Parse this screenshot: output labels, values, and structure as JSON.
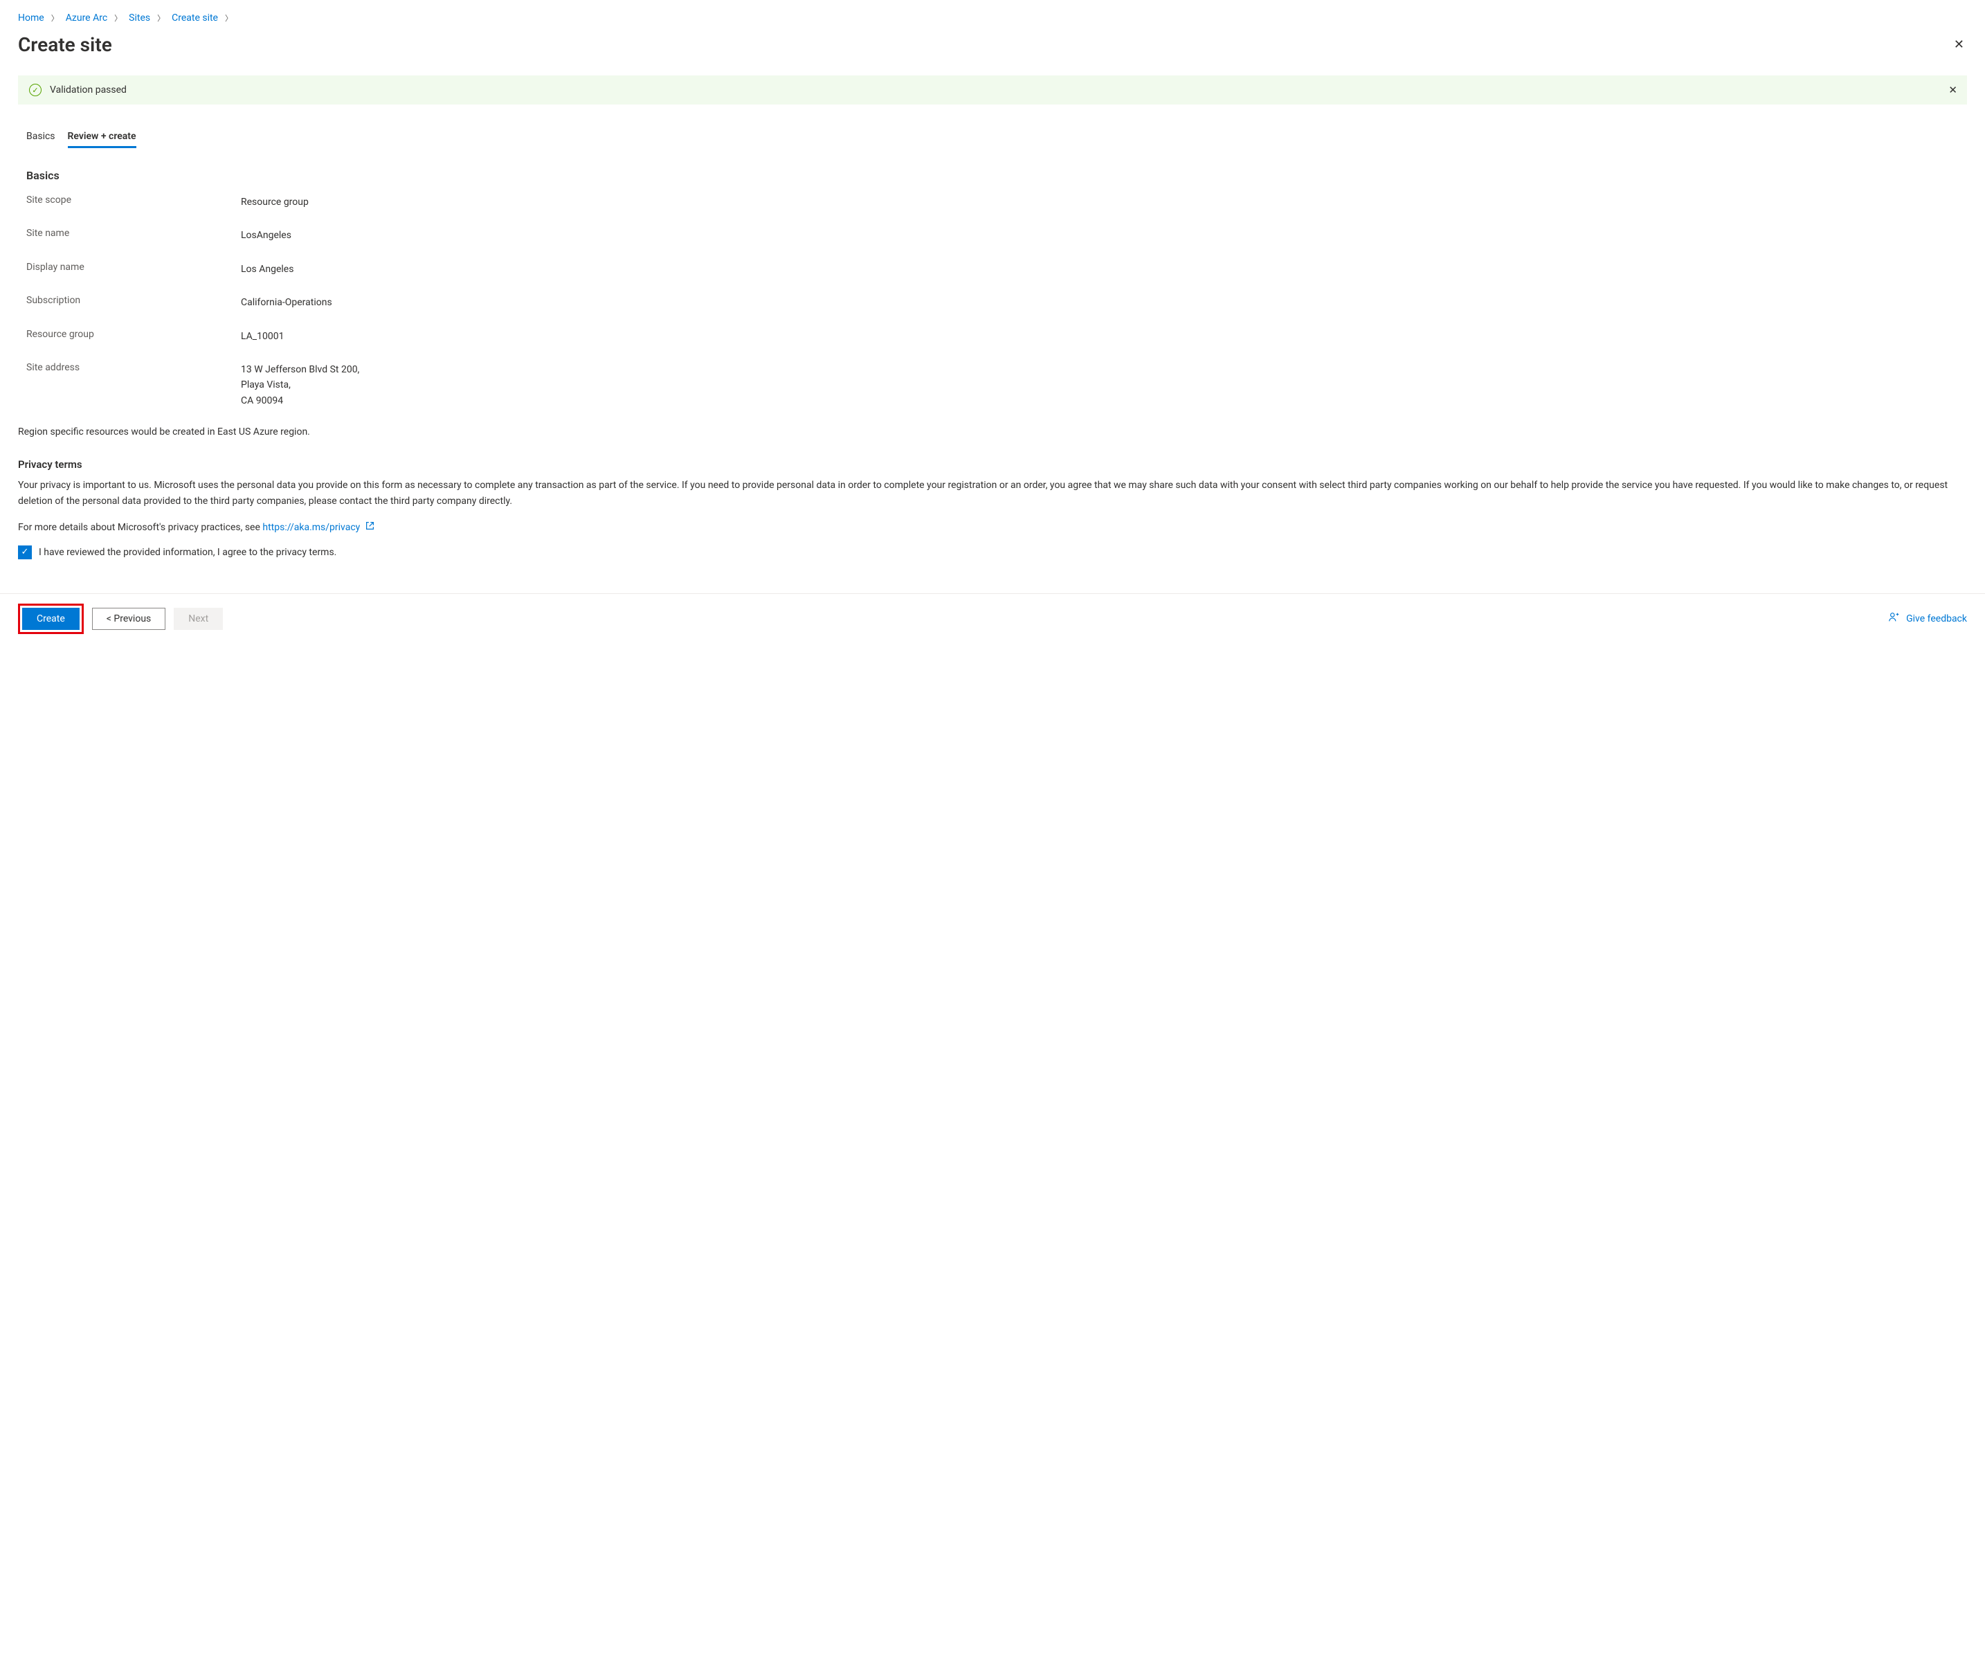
{
  "breadcrumb": {
    "items": [
      "Home",
      "Azure Arc",
      "Sites",
      "Create site"
    ]
  },
  "page": {
    "title": "Create site"
  },
  "banner": {
    "text": "Validation passed"
  },
  "tabs": {
    "basics": "Basics",
    "review": "Review + create"
  },
  "section": {
    "basics_heading": "Basics",
    "rows": {
      "site_scope": {
        "label": "Site scope",
        "value": "Resource group"
      },
      "site_name": {
        "label": "Site name",
        "value": "LosAngeles"
      },
      "display_name": {
        "label": "Display name",
        "value": "Los Angeles"
      },
      "subscription": {
        "label": "Subscription",
        "value": "California-Operations"
      },
      "resource_group": {
        "label": "Resource group",
        "value": "LA_10001"
      },
      "site_address": {
        "label": "Site address",
        "value": "13 W Jefferson Blvd St 200,\nPlaya Vista,\nCA 90094"
      }
    },
    "region_note": "Region specific resources would be created in East US Azure region."
  },
  "privacy": {
    "heading": "Privacy terms",
    "body": "Your privacy is important to us. Microsoft uses the personal data you provide on this form as necessary to complete any transaction as part of the service. If you need to provide personal data in order to complete your registration or an order, you agree that we may share such data with your consent with select third party companies working on our behalf to help provide the service you have requested. If you would like to make changes to, or request deletion of the personal data provided to the third party companies, please contact the third party company directly.",
    "link_prefix": "For more details about Microsoft's privacy practices, see ",
    "link_text": "https://aka.ms/privacy",
    "checkbox_label": "I have reviewed the provided information, I agree to the privacy terms."
  },
  "footer": {
    "create": "Create",
    "previous": "< Previous",
    "next": "Next",
    "feedback": "Give feedback"
  }
}
